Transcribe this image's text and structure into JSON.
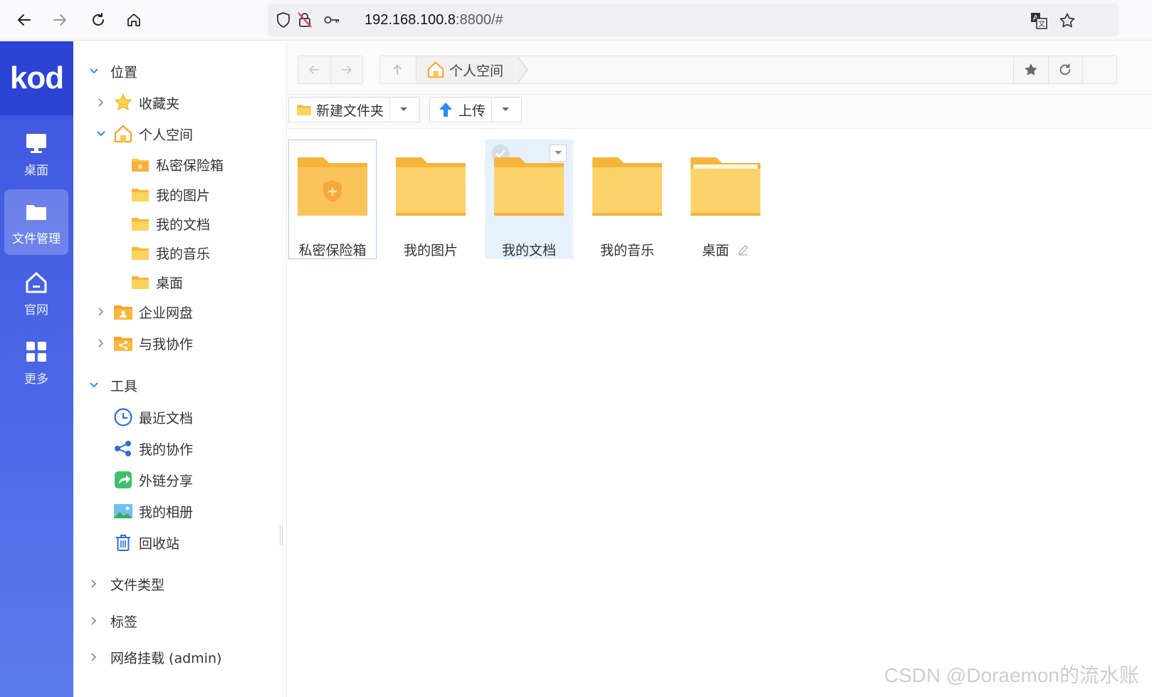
{
  "browser": {
    "url_host": "192.168.100.8",
    "url_rest": ":8800/#"
  },
  "rail": {
    "logo": "kod",
    "items": [
      {
        "label": "桌面"
      },
      {
        "label": "文件管理"
      },
      {
        "label": "官网"
      },
      {
        "label": "更多"
      }
    ]
  },
  "tree": {
    "sections": {
      "location": "位置",
      "tools": "工具",
      "file_types": "文件类型",
      "tags": "标签",
      "network_mount": "网络挂载 (admin)"
    },
    "favorites": "收藏夹",
    "personal_space": "个人空间",
    "personal_children": [
      "私密保险箱",
      "我的图片",
      "我的文档",
      "我的音乐",
      "桌面"
    ],
    "enterprise": "企业网盘",
    "shared_with_me": "与我协作",
    "tools_items": [
      "最近文档",
      "我的协作",
      "外链分享",
      "我的相册",
      "回收站"
    ]
  },
  "main": {
    "breadcrumb": "个人空间",
    "toolbar": {
      "new_folder": "新建文件夹",
      "upload": "上传"
    },
    "files": [
      {
        "name": "私密保险箱"
      },
      {
        "name": "我的图片"
      },
      {
        "name": "我的文档"
      },
      {
        "name": "我的音乐"
      },
      {
        "name": "桌面"
      }
    ]
  },
  "watermark": "CSDN @Doraemon的流水账",
  "colors": {
    "rail_blue": "#3d55e0",
    "folder_yellow": "#fbc64a",
    "selected_bg": "#e6f1fd"
  }
}
